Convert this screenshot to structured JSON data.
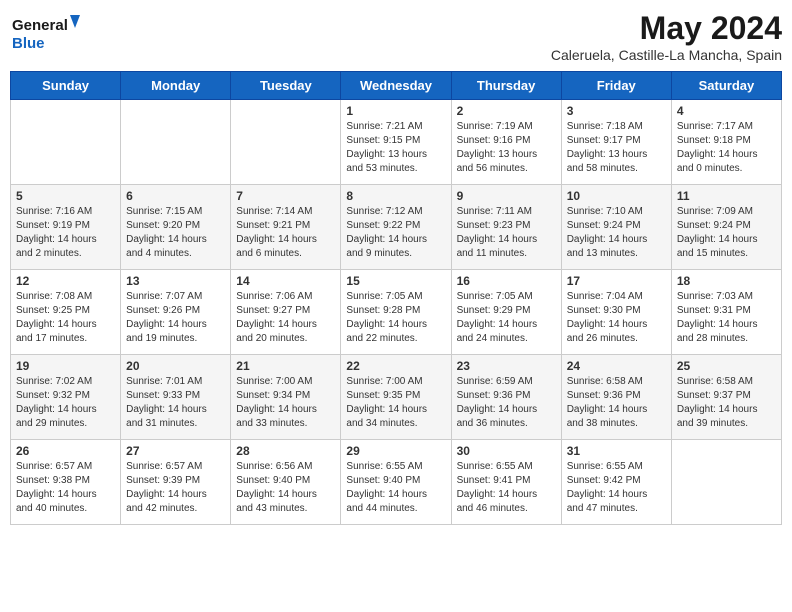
{
  "header": {
    "logo_line1": "General",
    "logo_line2": "Blue",
    "month": "May 2024",
    "location": "Caleruela, Castille-La Mancha, Spain"
  },
  "days_of_week": [
    "Sunday",
    "Monday",
    "Tuesday",
    "Wednesday",
    "Thursday",
    "Friday",
    "Saturday"
  ],
  "weeks": [
    [
      {
        "day": "",
        "info": ""
      },
      {
        "day": "",
        "info": ""
      },
      {
        "day": "",
        "info": ""
      },
      {
        "day": "1",
        "info": "Sunrise: 7:21 AM\nSunset: 9:15 PM\nDaylight: 13 hours and 53 minutes."
      },
      {
        "day": "2",
        "info": "Sunrise: 7:19 AM\nSunset: 9:16 PM\nDaylight: 13 hours and 56 minutes."
      },
      {
        "day": "3",
        "info": "Sunrise: 7:18 AM\nSunset: 9:17 PM\nDaylight: 13 hours and 58 minutes."
      },
      {
        "day": "4",
        "info": "Sunrise: 7:17 AM\nSunset: 9:18 PM\nDaylight: 14 hours and 0 minutes."
      }
    ],
    [
      {
        "day": "5",
        "info": "Sunrise: 7:16 AM\nSunset: 9:19 PM\nDaylight: 14 hours and 2 minutes."
      },
      {
        "day": "6",
        "info": "Sunrise: 7:15 AM\nSunset: 9:20 PM\nDaylight: 14 hours and 4 minutes."
      },
      {
        "day": "7",
        "info": "Sunrise: 7:14 AM\nSunset: 9:21 PM\nDaylight: 14 hours and 6 minutes."
      },
      {
        "day": "8",
        "info": "Sunrise: 7:12 AM\nSunset: 9:22 PM\nDaylight: 14 hours and 9 minutes."
      },
      {
        "day": "9",
        "info": "Sunrise: 7:11 AM\nSunset: 9:23 PM\nDaylight: 14 hours and 11 minutes."
      },
      {
        "day": "10",
        "info": "Sunrise: 7:10 AM\nSunset: 9:24 PM\nDaylight: 14 hours and 13 minutes."
      },
      {
        "day": "11",
        "info": "Sunrise: 7:09 AM\nSunset: 9:24 PM\nDaylight: 14 hours and 15 minutes."
      }
    ],
    [
      {
        "day": "12",
        "info": "Sunrise: 7:08 AM\nSunset: 9:25 PM\nDaylight: 14 hours and 17 minutes."
      },
      {
        "day": "13",
        "info": "Sunrise: 7:07 AM\nSunset: 9:26 PM\nDaylight: 14 hours and 19 minutes."
      },
      {
        "day": "14",
        "info": "Sunrise: 7:06 AM\nSunset: 9:27 PM\nDaylight: 14 hours and 20 minutes."
      },
      {
        "day": "15",
        "info": "Sunrise: 7:05 AM\nSunset: 9:28 PM\nDaylight: 14 hours and 22 minutes."
      },
      {
        "day": "16",
        "info": "Sunrise: 7:05 AM\nSunset: 9:29 PM\nDaylight: 14 hours and 24 minutes."
      },
      {
        "day": "17",
        "info": "Sunrise: 7:04 AM\nSunset: 9:30 PM\nDaylight: 14 hours and 26 minutes."
      },
      {
        "day": "18",
        "info": "Sunrise: 7:03 AM\nSunset: 9:31 PM\nDaylight: 14 hours and 28 minutes."
      }
    ],
    [
      {
        "day": "19",
        "info": "Sunrise: 7:02 AM\nSunset: 9:32 PM\nDaylight: 14 hours and 29 minutes."
      },
      {
        "day": "20",
        "info": "Sunrise: 7:01 AM\nSunset: 9:33 PM\nDaylight: 14 hours and 31 minutes."
      },
      {
        "day": "21",
        "info": "Sunrise: 7:00 AM\nSunset: 9:34 PM\nDaylight: 14 hours and 33 minutes."
      },
      {
        "day": "22",
        "info": "Sunrise: 7:00 AM\nSunset: 9:35 PM\nDaylight: 14 hours and 34 minutes."
      },
      {
        "day": "23",
        "info": "Sunrise: 6:59 AM\nSunset: 9:36 PM\nDaylight: 14 hours and 36 minutes."
      },
      {
        "day": "24",
        "info": "Sunrise: 6:58 AM\nSunset: 9:36 PM\nDaylight: 14 hours and 38 minutes."
      },
      {
        "day": "25",
        "info": "Sunrise: 6:58 AM\nSunset: 9:37 PM\nDaylight: 14 hours and 39 minutes."
      }
    ],
    [
      {
        "day": "26",
        "info": "Sunrise: 6:57 AM\nSunset: 9:38 PM\nDaylight: 14 hours and 40 minutes."
      },
      {
        "day": "27",
        "info": "Sunrise: 6:57 AM\nSunset: 9:39 PM\nDaylight: 14 hours and 42 minutes."
      },
      {
        "day": "28",
        "info": "Sunrise: 6:56 AM\nSunset: 9:40 PM\nDaylight: 14 hours and 43 minutes."
      },
      {
        "day": "29",
        "info": "Sunrise: 6:55 AM\nSunset: 9:40 PM\nDaylight: 14 hours and 44 minutes."
      },
      {
        "day": "30",
        "info": "Sunrise: 6:55 AM\nSunset: 9:41 PM\nDaylight: 14 hours and 46 minutes."
      },
      {
        "day": "31",
        "info": "Sunrise: 6:55 AM\nSunset: 9:42 PM\nDaylight: 14 hours and 47 minutes."
      },
      {
        "day": "",
        "info": ""
      }
    ]
  ]
}
